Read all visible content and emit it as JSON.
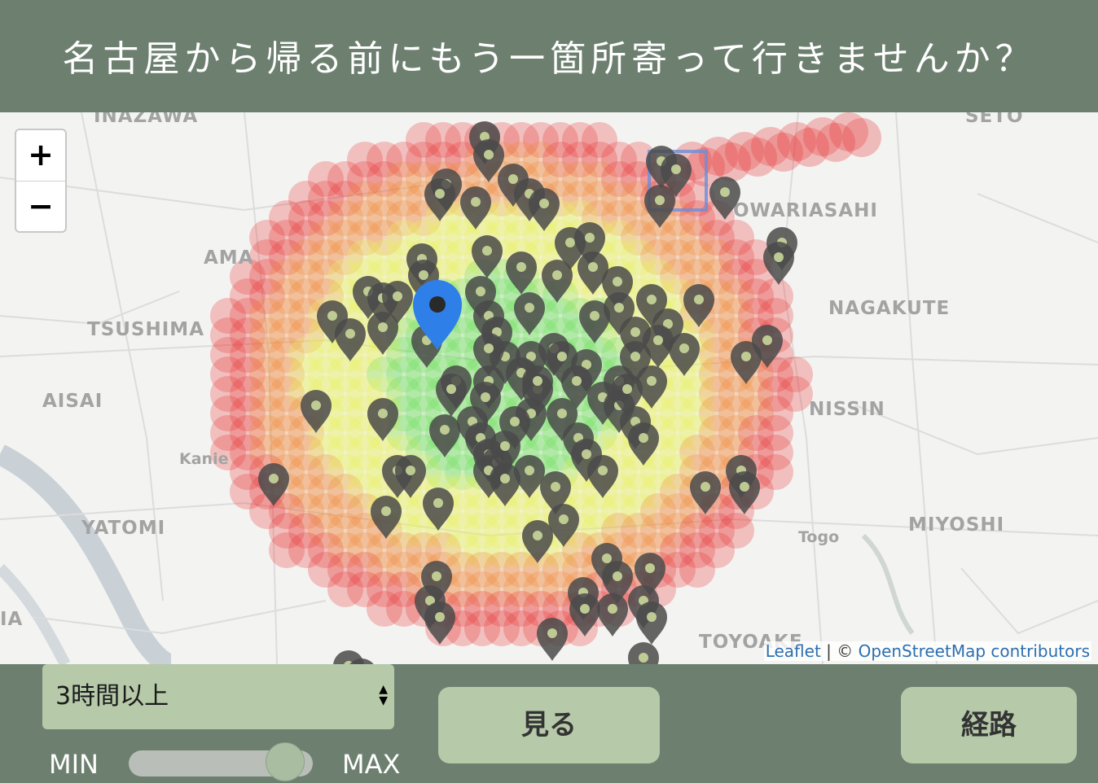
{
  "header": {
    "title": "名古屋から帰る前にもう一箇所寄って行きませんか？"
  },
  "map": {
    "places": [
      "INAZAWA",
      "SETO",
      "OWARIASAHI",
      "AMA",
      "TSUSHIMA",
      "NAGAKUTE",
      "AISAI",
      "NISSIN",
      "Kanie",
      "YATOMI",
      "Togo",
      "MIYOSHI",
      "TOYOAKE",
      "IA"
    ],
    "zoom_in": "+",
    "zoom_out": "−",
    "attribution_leaflet": "Leaflet",
    "attribution_sep": " | © ",
    "attribution_osm": "OpenStreetMap contributors",
    "heat_colors": {
      "low": "#6be05a",
      "mid": "#e8f05a",
      "high": "#f08a3a",
      "max": "#e83a3a"
    },
    "marker_color": "#4a4a4a",
    "current_location_color": "#2f7fe8"
  },
  "controls": {
    "duration_select": "3時間以上",
    "slider_min": "MIN",
    "slider_max": "MAX",
    "slider_value": 0.85,
    "see_button": "見る",
    "route_button": "経路"
  }
}
